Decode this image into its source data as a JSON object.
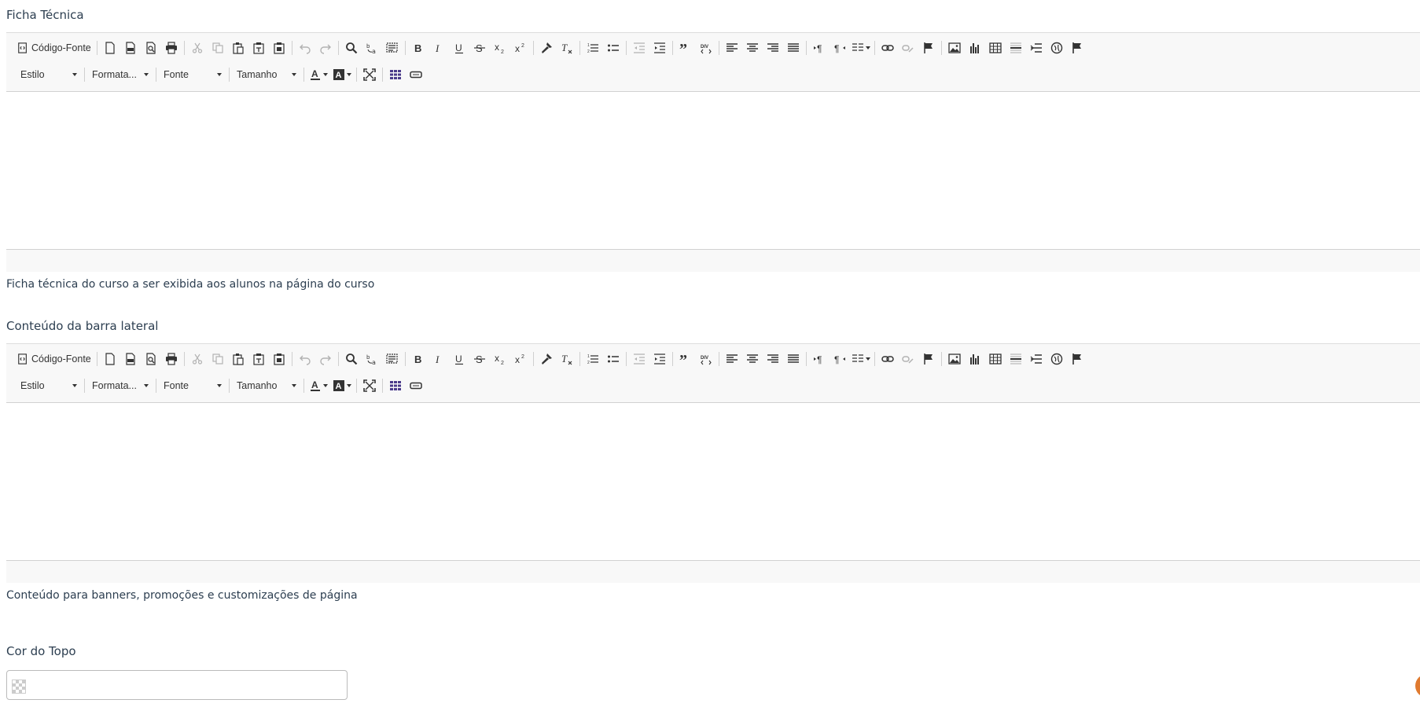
{
  "fields": {
    "ficha_label": "Ficha Técnica",
    "ficha_help": "Ficha técnica do curso a ser exibida aos alunos na página do curso",
    "sidebar_label": "Conteúdo da barra lateral",
    "sidebar_help": "Conteúdo para banners, promoções e customizações de página",
    "top_color_label": "Cor do Topo",
    "top_color_value": ""
  },
  "toolbar": {
    "source_label": "Código-Fonte",
    "style_combo": "Estilo",
    "format_combo": "Formata...",
    "font_combo": "Fonte",
    "size_combo": "Tamanho"
  },
  "colors": {
    "label_text": "#2c3e50",
    "toolbar_bg": "#f8f8f8",
    "accent_orange": "#e07a2f"
  },
  "icons": [
    "source-icon",
    "new-page-icon",
    "pdf-icon",
    "preview-icon",
    "print-icon",
    "cut-icon",
    "copy-icon",
    "paste-icon",
    "paste-text-icon",
    "paste-word-icon",
    "undo-icon",
    "redo-icon",
    "find-icon",
    "replace-icon",
    "select-all-icon",
    "bold-icon",
    "italic-icon",
    "underline-icon",
    "strike-icon",
    "subscript-icon",
    "superscript-icon",
    "copy-format-icon",
    "remove-format-icon",
    "numbered-list-icon",
    "bulleted-list-icon",
    "outdent-icon",
    "indent-icon",
    "blockquote-icon",
    "div-icon",
    "align-left-icon",
    "align-center-icon",
    "align-right-icon",
    "justify-icon",
    "ltr-icon",
    "rtl-icon",
    "language-icon",
    "link-icon",
    "unlink-icon",
    "anchor-icon",
    "image-icon",
    "chart-icon",
    "table-icon",
    "horizontal-line-icon",
    "page-break-icon",
    "iframe-icon",
    "flag-icon",
    "text-color-icon",
    "bg-color-icon",
    "maximize-icon",
    "show-blocks-icon",
    "button-icon"
  ]
}
